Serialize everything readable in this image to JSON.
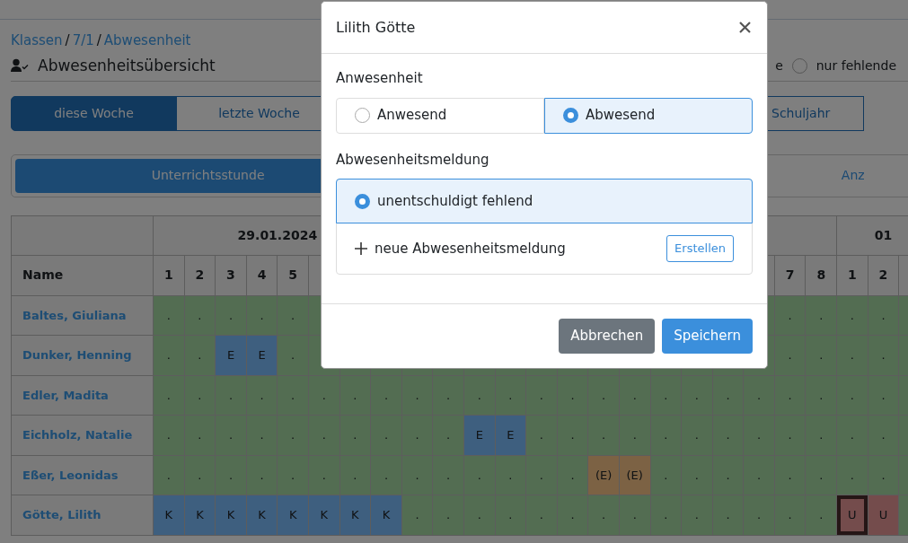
{
  "breadcrumb": [
    {
      "label": "Klassen",
      "kind": "link"
    },
    {
      "label": "/",
      "kind": "separator"
    },
    {
      "label": "7/1",
      "kind": "link"
    },
    {
      "label": "/",
      "kind": "separator"
    },
    {
      "label": "Abwesenheit",
      "kind": "link"
    }
  ],
  "heading": "Abwesenheitsübersicht",
  "filter_options": [
    {
      "label": "e"
    },
    {
      "label": "nur fehlende",
      "selected": false
    }
  ],
  "period_tabs": [
    {
      "label": "diese Woche",
      "selected": true
    },
    {
      "label": "letzte Woche",
      "selected": false
    },
    {
      "label": "Schuljahr",
      "selected": false
    }
  ],
  "view_toggle": [
    {
      "label": "Unterrichtsstunde",
      "selected": true
    },
    {
      "label": "Anz",
      "selected": false
    }
  ],
  "table": {
    "name_column": "Name",
    "days": [
      {
        "label": "29.01.2024",
        "periods": [
          "1",
          "2",
          "3",
          "4",
          "5"
        ]
      },
      {
        "periods": [
          "7",
          "8"
        ]
      },
      {
        "label": "01",
        "periods": [
          "1",
          "2"
        ]
      }
    ],
    "rows": [
      {
        "name": "Baltes, Giuliana",
        "cells": [
          {
            "text": ".",
            "kind": "present",
            "selected": false
          },
          {
            "text": ".",
            "kind": "present",
            "selected": false
          },
          {
            "text": ".",
            "kind": "present",
            "selected": false
          },
          {
            "text": ".",
            "kind": "present",
            "selected": false
          },
          {
            "text": ".",
            "kind": "present",
            "selected": false
          },
          null,
          null,
          null,
          null,
          null,
          null,
          null,
          null,
          null,
          null,
          null,
          null,
          null,
          null,
          null,
          {
            "text": ".",
            "kind": "present",
            "selected": false
          },
          {
            "text": ".",
            "kind": "present",
            "selected": false
          },
          {
            "text": ".",
            "kind": "present",
            "selected": false
          },
          {
            "text": ".",
            "kind": "present",
            "selected": false
          },
          null
        ]
      },
      {
        "name": "Dunker, Henning",
        "cells": [
          {
            "text": ".",
            "kind": "present",
            "selected": false
          },
          {
            "text": ".",
            "kind": "present",
            "selected": false
          },
          {
            "text": "E",
            "kind": "excused",
            "selected": false
          },
          {
            "text": "E",
            "kind": "excused",
            "selected": false
          },
          {
            "text": ".",
            "kind": "present",
            "selected": false
          },
          null,
          null,
          null,
          null,
          null,
          null,
          null,
          null,
          null,
          null,
          null,
          null,
          null,
          null,
          null,
          {
            "text": ".",
            "kind": "present",
            "selected": false
          },
          {
            "text": ".",
            "kind": "present",
            "selected": false
          },
          {
            "text": ".",
            "kind": "present",
            "selected": false
          },
          {
            "text": ".",
            "kind": "present",
            "selected": false
          },
          null
        ]
      },
      {
        "name": "Edler, Madita",
        "cells": [
          {
            "text": ".",
            "kind": "present",
            "selected": false
          },
          {
            "text": ".",
            "kind": "present",
            "selected": false
          },
          {
            "text": ".",
            "kind": "present",
            "selected": false
          },
          {
            "text": ".",
            "kind": "present",
            "selected": false
          },
          {
            "text": ".",
            "kind": "present",
            "selected": false
          },
          {
            "text": ".",
            "kind": "present",
            "selected": false
          },
          {
            "text": ".",
            "kind": "present",
            "selected": false
          },
          {
            "text": ".",
            "kind": "present",
            "selected": false
          },
          {
            "text": ".",
            "kind": "present",
            "selected": false
          },
          {
            "text": ".",
            "kind": "present",
            "selected": false
          },
          {
            "text": ".",
            "kind": "present",
            "selected": false
          },
          {
            "text": ".",
            "kind": "present",
            "selected": false
          },
          {
            "text": ".",
            "kind": "present",
            "selected": false
          },
          {
            "text": ".",
            "kind": "present",
            "selected": false
          },
          {
            "text": ".",
            "kind": "present",
            "selected": false
          },
          {
            "text": ".",
            "kind": "present",
            "selected": false
          },
          {
            "text": ".",
            "kind": "present",
            "selected": false
          },
          {
            "text": ".",
            "kind": "present",
            "selected": false
          },
          {
            "text": ".",
            "kind": "present",
            "selected": false
          },
          {
            "text": ".",
            "kind": "present",
            "selected": false
          },
          {
            "text": ".",
            "kind": "present",
            "selected": false
          },
          {
            "text": ".",
            "kind": "present",
            "selected": false
          },
          {
            "text": ".",
            "kind": "present",
            "selected": false
          },
          {
            "text": ".",
            "kind": "present",
            "selected": false
          },
          null
        ]
      },
      {
        "name": "Eichholz, Natalie",
        "cells": [
          {
            "text": ".",
            "kind": "present",
            "selected": false
          },
          {
            "text": ".",
            "kind": "present",
            "selected": false
          },
          {
            "text": ".",
            "kind": "present",
            "selected": false
          },
          {
            "text": ".",
            "kind": "present",
            "selected": false
          },
          {
            "text": ".",
            "kind": "present",
            "selected": false
          },
          {
            "text": ".",
            "kind": "present",
            "selected": false
          },
          {
            "text": ".",
            "kind": "present",
            "selected": false
          },
          {
            "text": ".",
            "kind": "present",
            "selected": false
          },
          {
            "text": ".",
            "kind": "present",
            "selected": false
          },
          {
            "text": ".",
            "kind": "present",
            "selected": false
          },
          {
            "text": "E",
            "kind": "excused",
            "selected": false
          },
          {
            "text": "E",
            "kind": "excused",
            "selected": false
          },
          {
            "text": ".",
            "kind": "present",
            "selected": false
          },
          {
            "text": ".",
            "kind": "present",
            "selected": false
          },
          {
            "text": ".",
            "kind": "present",
            "selected": false
          },
          {
            "text": ".",
            "kind": "present",
            "selected": false
          },
          {
            "text": ".",
            "kind": "present",
            "selected": false
          },
          {
            "text": ".",
            "kind": "present",
            "selected": false
          },
          {
            "text": ".",
            "kind": "present",
            "selected": false
          },
          {
            "text": ".",
            "kind": "present",
            "selected": false
          },
          {
            "text": ".",
            "kind": "present",
            "selected": false
          },
          {
            "text": ".",
            "kind": "present",
            "selected": false
          },
          {
            "text": ".",
            "kind": "present",
            "selected": false
          },
          {
            "text": ".",
            "kind": "present",
            "selected": false
          },
          null
        ]
      },
      {
        "name": "Eßer, Leonidas",
        "cells": [
          {
            "text": ".",
            "kind": "present",
            "selected": false
          },
          {
            "text": ".",
            "kind": "present",
            "selected": false
          },
          {
            "text": ".",
            "kind": "present",
            "selected": false
          },
          {
            "text": ".",
            "kind": "present",
            "selected": false
          },
          {
            "text": ".",
            "kind": "present",
            "selected": false
          },
          {
            "text": ".",
            "kind": "present",
            "selected": false
          },
          {
            "text": ".",
            "kind": "present",
            "selected": false
          },
          {
            "text": ".",
            "kind": "present",
            "selected": false
          },
          {
            "text": ".",
            "kind": "present",
            "selected": false
          },
          {
            "text": ".",
            "kind": "present",
            "selected": false
          },
          {
            "text": ".",
            "kind": "present",
            "selected": false
          },
          {
            "text": ".",
            "kind": "present",
            "selected": false
          },
          {
            "text": ".",
            "kind": "present",
            "selected": false
          },
          {
            "text": ".",
            "kind": "present",
            "selected": false
          },
          {
            "text": "(E)",
            "kind": "pending",
            "selected": false
          },
          {
            "text": "(E)",
            "kind": "pending",
            "selected": false
          },
          {
            "text": ".",
            "kind": "present",
            "selected": false
          },
          {
            "text": ".",
            "kind": "present",
            "selected": false
          },
          {
            "text": ".",
            "kind": "present",
            "selected": false
          },
          {
            "text": ".",
            "kind": "present",
            "selected": false
          },
          {
            "text": ".",
            "kind": "present",
            "selected": false
          },
          {
            "text": ".",
            "kind": "present",
            "selected": false
          },
          {
            "text": ".",
            "kind": "present",
            "selected": false
          },
          {
            "text": ".",
            "kind": "present",
            "selected": false
          },
          null
        ]
      },
      {
        "name": "Götte, Lilith",
        "cells": [
          {
            "text": "K",
            "kind": "sick",
            "selected": false
          },
          {
            "text": "K",
            "kind": "sick",
            "selected": false
          },
          {
            "text": "K",
            "kind": "sick",
            "selected": false
          },
          {
            "text": "K",
            "kind": "sick",
            "selected": false
          },
          {
            "text": "K",
            "kind": "sick",
            "selected": false
          },
          {
            "text": "K",
            "kind": "sick",
            "selected": false
          },
          {
            "text": "K",
            "kind": "sick",
            "selected": false
          },
          {
            "text": "K",
            "kind": "sick",
            "selected": false
          },
          {
            "text": ".",
            "kind": "present",
            "selected": false
          },
          {
            "text": ".",
            "kind": "present",
            "selected": false
          },
          {
            "text": ".",
            "kind": "present",
            "selected": false
          },
          {
            "text": ".",
            "kind": "present",
            "selected": false
          },
          {
            "text": ".",
            "kind": "present",
            "selected": false
          },
          {
            "text": ".",
            "kind": "present",
            "selected": false
          },
          {
            "text": ".",
            "kind": "present",
            "selected": false
          },
          {
            "text": ".",
            "kind": "present",
            "selected": false
          },
          {
            "text": ".",
            "kind": "present",
            "selected": false
          },
          {
            "text": ".",
            "kind": "present",
            "selected": false
          },
          {
            "text": ".",
            "kind": "present",
            "selected": false
          },
          {
            "text": ".",
            "kind": "present",
            "selected": false
          },
          {
            "text": ".",
            "kind": "present",
            "selected": false
          },
          {
            "text": ".",
            "kind": "present",
            "selected": false
          },
          {
            "text": "U",
            "kind": "unexcused",
            "selected": true
          },
          {
            "text": "U",
            "kind": "unexcused",
            "selected": false
          },
          null
        ]
      }
    ]
  },
  "modal": {
    "title": "Lilith Götte",
    "attendance_label": "Anwesenheit",
    "attendance_options": [
      {
        "label": "Anwesend",
        "selected": false
      },
      {
        "label": "Abwesend",
        "selected": true
      }
    ],
    "notice_label": "Abwesenheitsmeldung",
    "notices": [
      {
        "label": "unentschuldigt fehlend",
        "selected": true
      }
    ],
    "new_notice": {
      "label": "neue Abwesenheitsmeldung",
      "button": "Erstellen"
    },
    "buttons": [
      {
        "label": "Abbrechen",
        "kind": "secondary"
      },
      {
        "label": "Speichern",
        "kind": "primary"
      }
    ]
  }
}
